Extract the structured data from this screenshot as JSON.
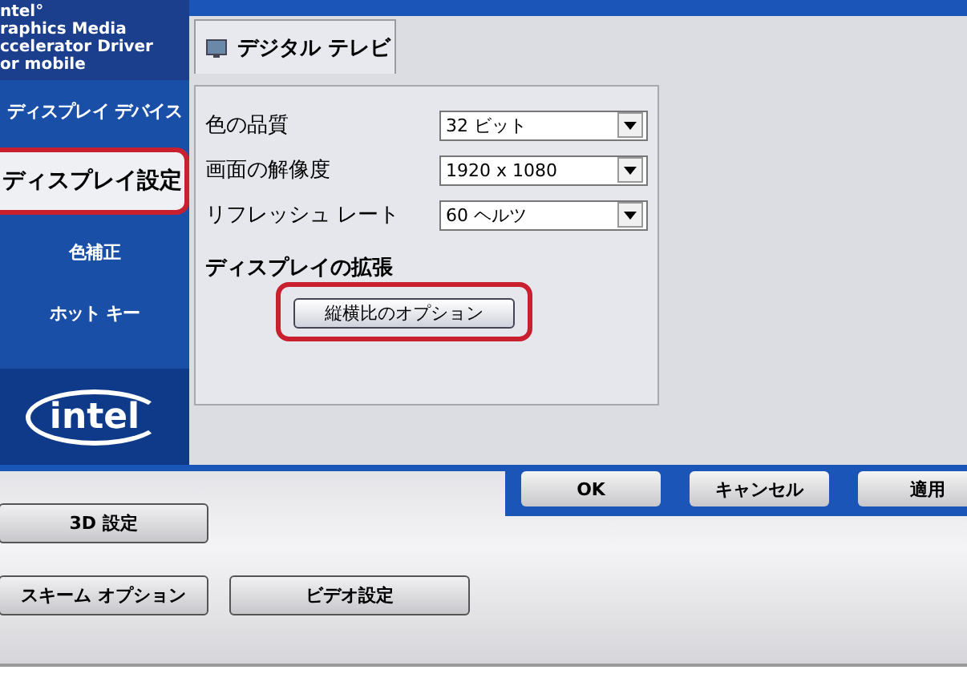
{
  "sidebar": {
    "header": [
      "ntel°",
      "raphics Media",
      "ccelerator Driver",
      "or mobile"
    ],
    "items": [
      {
        "label": "ディスプレイ デバイス",
        "selected": false,
        "annotated": false
      },
      {
        "label": "ディスプレイ設定",
        "selected": true,
        "annotated": true
      },
      {
        "label": "色補正",
        "selected": false,
        "annotated": false
      },
      {
        "label": "ホット キー",
        "selected": false,
        "annotated": false
      }
    ],
    "logo": "intel"
  },
  "tab": {
    "label": "デジタル テレビ",
    "selected": true
  },
  "settings": [
    {
      "label": "色の品質",
      "value": "32 ビット"
    },
    {
      "label": "画面の解像度",
      "value": "1920 x 1080"
    },
    {
      "label": "リフレッシュ レート",
      "value": "60 ヘルツ"
    }
  ],
  "section": {
    "heading": "ディスプレイの拡張",
    "button": {
      "label": "縦横比のオプション",
      "annotated": true
    }
  },
  "dialog_buttons": [
    "OK",
    "キャンセル",
    "適用"
  ],
  "bottom_buttons": [
    [
      "3D 設定"
    ],
    [
      "スキーム オプション",
      "ビデオ設定"
    ]
  ]
}
